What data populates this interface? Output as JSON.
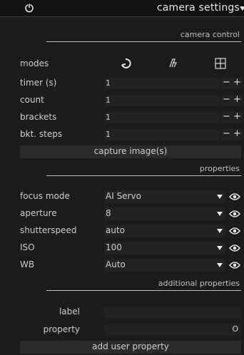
{
  "header": {
    "title": "camera settings",
    "power_icon": "power-icon",
    "chevron_icon": "chevron-down-icon"
  },
  "camera_control": {
    "section_title": "camera control",
    "modes_label": "modes",
    "mode_icons": [
      "single-shot-mode-icon",
      "sequence-mode-icon",
      "bracket-grid-mode-icon"
    ],
    "timer": {
      "label": "timer (s)",
      "value": "1"
    },
    "count": {
      "label": "count",
      "value": "1"
    },
    "brackets": {
      "label": "brackets",
      "value": "1"
    },
    "bkt_steps": {
      "label": "bkt. steps",
      "value": "1"
    },
    "stepper_minus": "−",
    "stepper_plus": "+",
    "capture_button": "capture image(s)"
  },
  "properties": {
    "section_title": "properties",
    "rows": [
      {
        "label": "focus mode",
        "value": "AI Servo"
      },
      {
        "label": "aperture",
        "value": "8"
      },
      {
        "label": "shutterspeed",
        "value": "auto"
      },
      {
        "label": "ISO",
        "value": "100"
      },
      {
        "label": "WB",
        "value": "Auto"
      }
    ]
  },
  "additional_properties": {
    "section_title": "additional properties",
    "label_field": {
      "label": "label",
      "value": ""
    },
    "property_field": {
      "label": "property",
      "value": "",
      "suffix": "O"
    },
    "add_button": "add user property"
  },
  "colors": {
    "background": "#1b1b1b",
    "field": "#222222",
    "button": "#2a2a2a",
    "text": "#c4c4c4"
  }
}
